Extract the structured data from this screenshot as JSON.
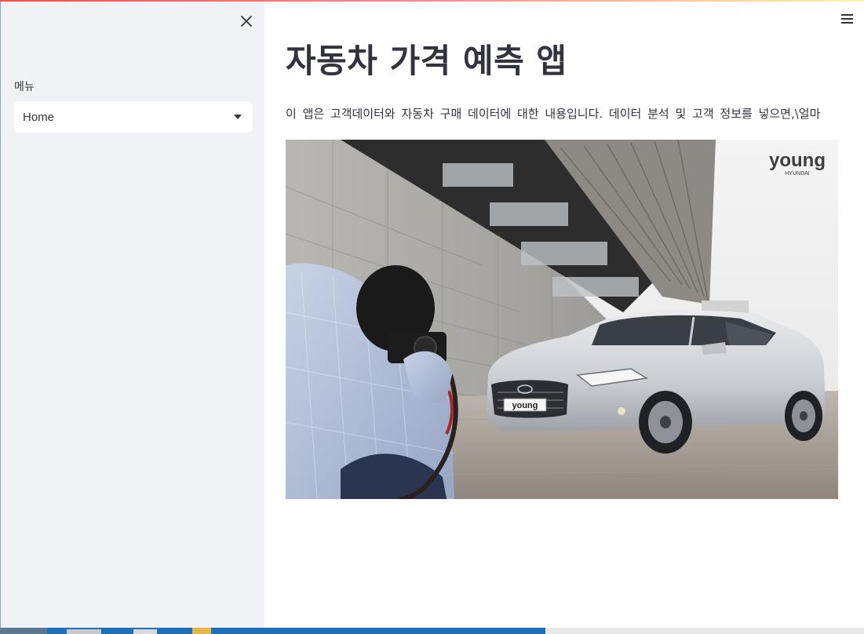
{
  "sidebar": {
    "close_icon": "close-icon",
    "menu_label": "메뉴",
    "select_value": "Home",
    "select_caret_icon": "caret-down-icon"
  },
  "main": {
    "menu_icon": "hamburger-menu-icon",
    "title": "자동차 가격 예측 앱",
    "description": "이 앱은 고객데이터와 자동차 구매 데이터에 대한 내용입니다. 데이터 분석 및 고객 정보를 넣으면,\\얼마",
    "hero_image": {
      "logo_text": "young",
      "logo_subtext": "HYUNDAI",
      "plate_text": "young"
    }
  },
  "colors": {
    "sidebar_bg": "#f0f2f6",
    "text": "#31333f",
    "accent": "#ff4b4b"
  }
}
